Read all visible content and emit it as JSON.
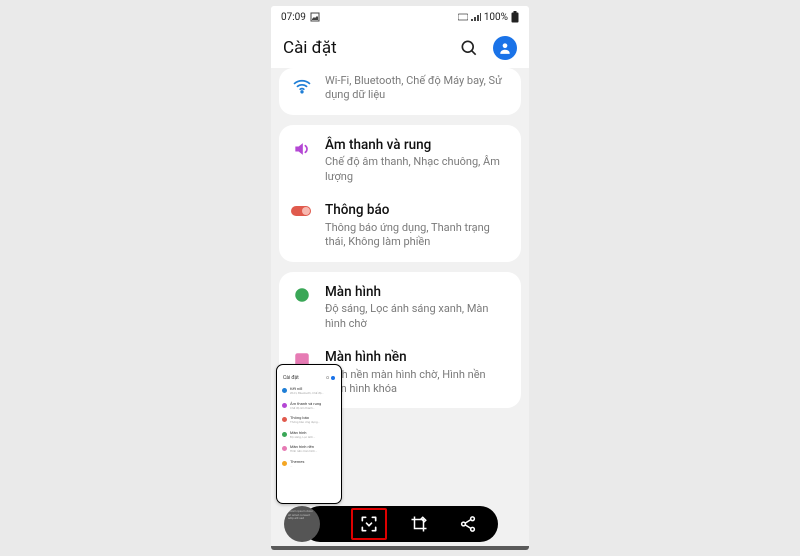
{
  "status": {
    "time": "07:09",
    "battery": "100%"
  },
  "header": {
    "title": "Cài đặt"
  },
  "cards": [
    {
      "rows": [
        {
          "icon": "wifi-icon",
          "iconColor": "#1f7ed6",
          "title": "",
          "subtitle": "Wi-Fi, Bluetooth, Chế độ Máy bay, Sử dụng dữ liệu"
        }
      ]
    },
    {
      "rows": [
        {
          "icon": "volume-icon",
          "iconColor": "#b447d4",
          "title": "Âm thanh và rung",
          "subtitle": "Chế độ âm thanh, Nhạc chuông, Âm lượng"
        },
        {
          "icon": "toggle-icon",
          "iconColor": "#e05a4d",
          "title": "Thông báo",
          "subtitle": "Thông báo ứng dụng, Thanh trạng thái, Không làm phiền"
        }
      ]
    },
    {
      "rows": [
        {
          "icon": "display-icon",
          "iconColor": "#3aa757",
          "title": "Màn hình",
          "subtitle": "Độ sáng, Lọc ánh sáng xanh, Màn hình chờ"
        },
        {
          "icon": "wallpaper-icon",
          "iconColor": "#e67bb4",
          "title": "Màn hình nền",
          "subtitle": "Hình nền màn hình chờ, Hình nền màn hình khóa"
        }
      ]
    }
  ],
  "thumb": {
    "title": "Cài đặt",
    "items": [
      {
        "title": "Kết nối",
        "sub": "Wi-Fi, Bluetooth..."
      },
      {
        "title": "Âm thanh và rung",
        "sub": "..."
      },
      {
        "title": "Thông báo",
        "sub": "..."
      },
      {
        "title": "Màn hình",
        "sub": "..."
      },
      {
        "title": "Màn hình nền",
        "sub": "..."
      },
      {
        "title": "Themes",
        "sub": "..."
      }
    ]
  }
}
